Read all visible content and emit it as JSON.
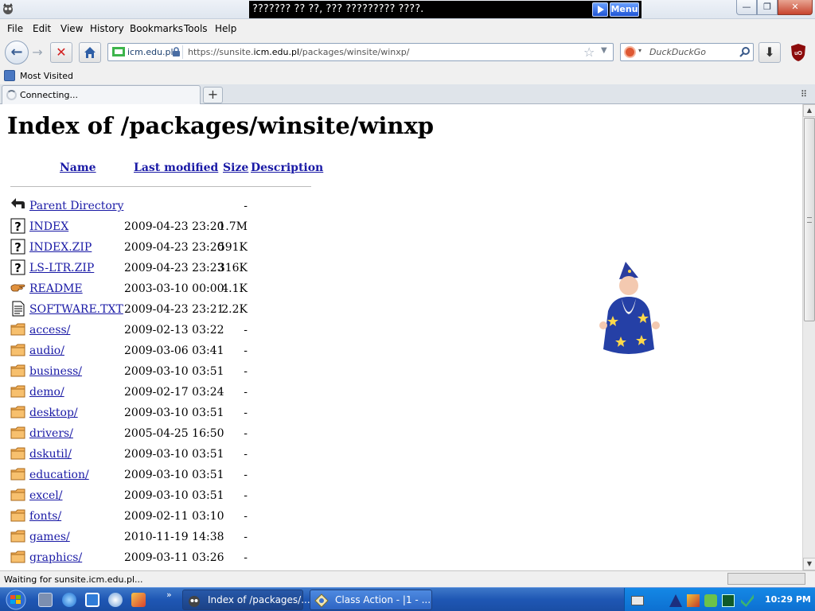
{
  "window": {
    "title_overlay": "??????? ?? ??, ??? ????????? ????.",
    "menu_label": "Menu",
    "minimize": "—",
    "maximize": "❐",
    "close": "✕"
  },
  "menubar": [
    "File",
    "Edit",
    "View",
    "History",
    "Bookmarks",
    "Tools",
    "Help"
  ],
  "navbar": {
    "back": "←",
    "forward": "→",
    "stop": "✕",
    "identity": "icm.edu.pl",
    "url_prefix": "https://sunsite.",
    "url_domain": "icm.edu.pl",
    "url_path": "/packages/winsite/winxp/",
    "bookmark_star": "☆",
    "url_dropdown": "▼",
    "search_placeholder": "DuckDuckGo",
    "search_engine_drop": "▾",
    "downloads": "⬇",
    "ublock_label": "uO"
  },
  "bookmarks": {
    "most_visited": "Most Visited"
  },
  "tabs": {
    "active_label": "Connecting...",
    "new_tab": "+",
    "tab_list": "⠿"
  },
  "page": {
    "heading": "Index of /packages/winsite/winxp",
    "columns": {
      "name": "Name",
      "modified": "Last modified",
      "size": "Size",
      "description": "Description"
    },
    "rows": [
      {
        "icon": "back-icon",
        "name": "Parent Directory",
        "date": "",
        "size": "-"
      },
      {
        "icon": "unknown-icon",
        "name": "INDEX",
        "date": "2009-04-23 23:20",
        "size": "1.7M"
      },
      {
        "icon": "unknown-icon",
        "name": "INDEX.ZIP",
        "date": "2009-04-23 23:20",
        "size": "591K"
      },
      {
        "icon": "unknown-icon",
        "name": "LS-LTR.ZIP",
        "date": "2009-04-23 23:23",
        "size": "316K"
      },
      {
        "icon": "hand-icon",
        "name": "README",
        "date": "2003-03-10 00:00",
        "size": "4.1K"
      },
      {
        "icon": "text-icon",
        "name": "SOFTWARE.TXT",
        "date": "2009-04-23 23:21",
        "size": "2.2K"
      },
      {
        "icon": "folder-icon",
        "name": "access/",
        "date": "2009-02-13 03:22",
        "size": "-"
      },
      {
        "icon": "folder-icon",
        "name": "audio/",
        "date": "2009-03-06 03:41",
        "size": "-"
      },
      {
        "icon": "folder-icon",
        "name": "business/",
        "date": "2009-03-10 03:51",
        "size": "-"
      },
      {
        "icon": "folder-icon",
        "name": "demo/",
        "date": "2009-02-17 03:24",
        "size": "-"
      },
      {
        "icon": "folder-icon",
        "name": "desktop/",
        "date": "2009-03-10 03:51",
        "size": "-"
      },
      {
        "icon": "folder-icon",
        "name": "drivers/",
        "date": "2005-04-25 16:50",
        "size": "-"
      },
      {
        "icon": "folder-icon",
        "name": "dskutil/",
        "date": "2009-03-10 03:51",
        "size": "-"
      },
      {
        "icon": "folder-icon",
        "name": "education/",
        "date": "2009-03-10 03:51",
        "size": "-"
      },
      {
        "icon": "folder-icon",
        "name": "excel/",
        "date": "2009-03-10 03:51",
        "size": "-"
      },
      {
        "icon": "folder-icon",
        "name": "fonts/",
        "date": "2009-02-11 03:10",
        "size": "-"
      },
      {
        "icon": "folder-icon",
        "name": "games/",
        "date": "2010-11-19 14:38",
        "size": "-"
      },
      {
        "icon": "folder-icon",
        "name": "graphics/",
        "date": "2009-03-11 03:26",
        "size": "-"
      }
    ]
  },
  "statusbar": {
    "text": "Waiting for sunsite.icm.edu.pl..."
  },
  "taskbar": {
    "quicklaunch_chevron": "»",
    "tasks": [
      {
        "label": "Index of /packages/...",
        "icon": "firefox-icon"
      },
      {
        "label": "Class Action - |1  -  ...",
        "icon": "classaction-icon"
      }
    ],
    "clock": "10:29 PM"
  },
  "colors": {
    "link": "#1a1aa6",
    "taskbar": "#1f57b4",
    "tray": "#0d6fd0"
  }
}
